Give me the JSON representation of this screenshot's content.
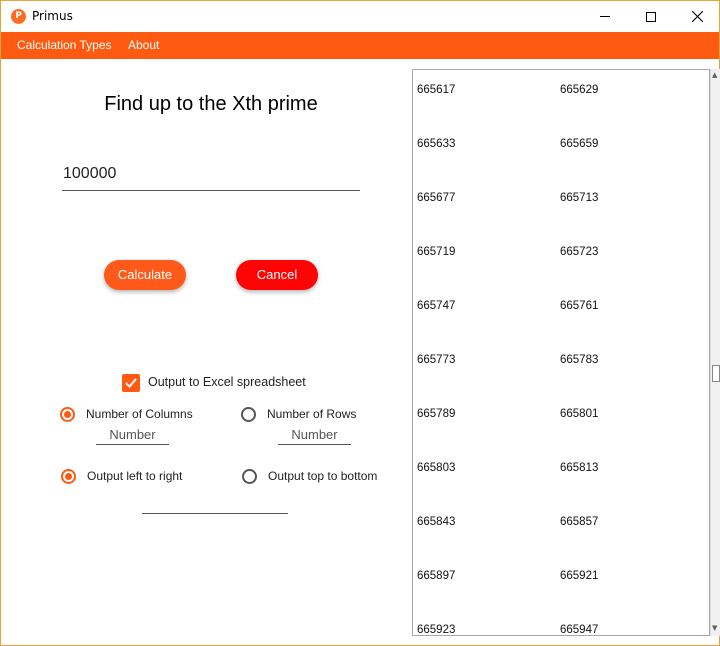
{
  "window": {
    "title": "Primus",
    "icon_letter": "P",
    "accent_color": "#ff5a11"
  },
  "menu": {
    "items": [
      "Calculation Types",
      "About"
    ]
  },
  "main": {
    "heading": "Find up to the Xth prime",
    "input_value": "100000",
    "calculate_label": "Calculate",
    "cancel_label": "Cancel"
  },
  "excel": {
    "checkbox_label": "Output to Excel spreadsheet",
    "checkbox_checked": true,
    "columns_label": "Number of Columns",
    "columns_placeholder": "Number",
    "rows_label": "Number of Rows",
    "rows_placeholder": "Number",
    "left_to_right_label": "Output left to right",
    "top_to_bottom_label": "Output top to bottom",
    "selected_dimension": "Number of Columns",
    "selected_direction": "Output left to right"
  },
  "results": {
    "rows": [
      [
        "665617",
        "665629"
      ],
      [
        "665633",
        "665659"
      ],
      [
        "665677",
        "665713"
      ],
      [
        "665719",
        "665723"
      ],
      [
        "665747",
        "665761"
      ],
      [
        "665773",
        "665783"
      ],
      [
        "665789",
        "665801"
      ],
      [
        "665803",
        "665813"
      ],
      [
        "665843",
        "665857"
      ],
      [
        "665897",
        "665921"
      ],
      [
        "665923",
        "665947"
      ]
    ]
  }
}
